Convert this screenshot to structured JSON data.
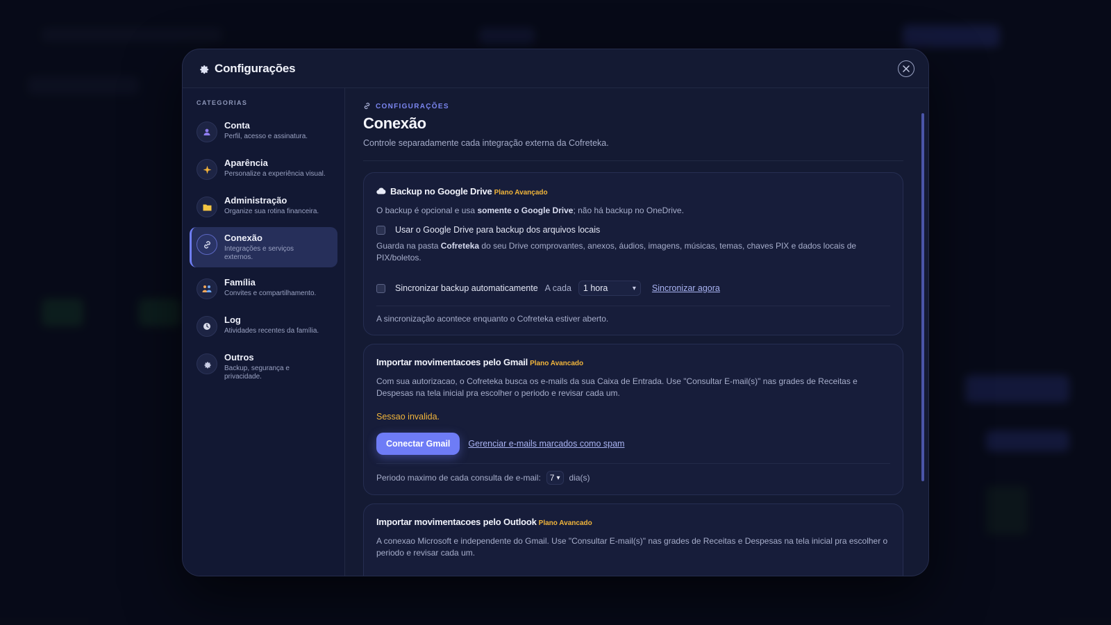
{
  "modal": {
    "title": "Configurações"
  },
  "sidebar": {
    "heading": "CATEGORIAS",
    "items": [
      {
        "label": "Conta",
        "desc": "Perfil, acesso e assinatura.",
        "icon": "user-icon"
      },
      {
        "label": "Aparência",
        "desc": "Personalize a experiência visual.",
        "icon": "sparkle-icon"
      },
      {
        "label": "Administração",
        "desc": "Organize sua rotina financeira.",
        "icon": "folder-icon"
      },
      {
        "label": "Conexão",
        "desc": "Integrações e serviços externos.",
        "icon": "link-icon"
      },
      {
        "label": "Família",
        "desc": "Convites e compartilhamento.",
        "icon": "family-icon"
      },
      {
        "label": "Log",
        "desc": "Atividades recentes da família.",
        "icon": "clock-icon"
      },
      {
        "label": "Outros",
        "desc": "Backup, segurança e privacidade.",
        "icon": "gear-icon"
      }
    ]
  },
  "content": {
    "breadcrumb": "CONFIGURAÇÕES",
    "title": "Conexão",
    "subtitle": "Controle separadamente cada integração externa da Cofreteka.",
    "drive": {
      "title": "Backup no Google Drive",
      "plan": "Plano Avançado",
      "desc_a": "O backup é opcional e usa ",
      "desc_b": "somente o Google Drive",
      "desc_c": "; não há backup no OneDrive.",
      "check_label": "Usar o Google Drive para backup dos arquivos locais",
      "store_a": "Guarda na pasta ",
      "store_b": "Cofreteka",
      "store_c": " do seu Drive comprovantes, anexos, áudios, imagens, músicas, temas, chaves PIX e dados locais de PIX/boletos.",
      "sync_label": "Sincronizar backup automaticamente",
      "every_label": "A cada",
      "interval": "1 hora",
      "sync_now": "Sincronizar agora",
      "note": "A sincronização acontece enquanto o Cofreteka estiver aberto."
    },
    "gmail": {
      "title": "Importar movimentacoes pelo Gmail",
      "plan": "Plano Avancado",
      "desc": "Com sua autorizacao, o Cofreteka busca os e-mails da sua Caixa de Entrada. Use \"Consultar E-mail(s)\" nas grades de Receitas e Despesas na tela inicial pra escolher o periodo e revisar cada um.",
      "status": "Sessao invalida.",
      "connect": "Conectar Gmail",
      "spam_link": "Gerenciar e-mails marcados como spam",
      "period_label": "Periodo maximo de cada consulta de e-mail:",
      "period_value": "7",
      "period_unit": "dia(s)"
    },
    "outlook": {
      "title": "Importar movimentacoes pelo Outlook",
      "plan": "Plano Avancado",
      "desc": "A conexao Microsoft e independente do Gmail. Use \"Consultar E-mail(s)\" nas grades de Receitas e Despesas na tela inicial pra escolher o periodo e revisar cada um."
    }
  },
  "colors": {
    "accent": "#6e7cf6",
    "plan": "#f1b53b",
    "background": "#0b0f1f",
    "modal": "#141a33"
  }
}
